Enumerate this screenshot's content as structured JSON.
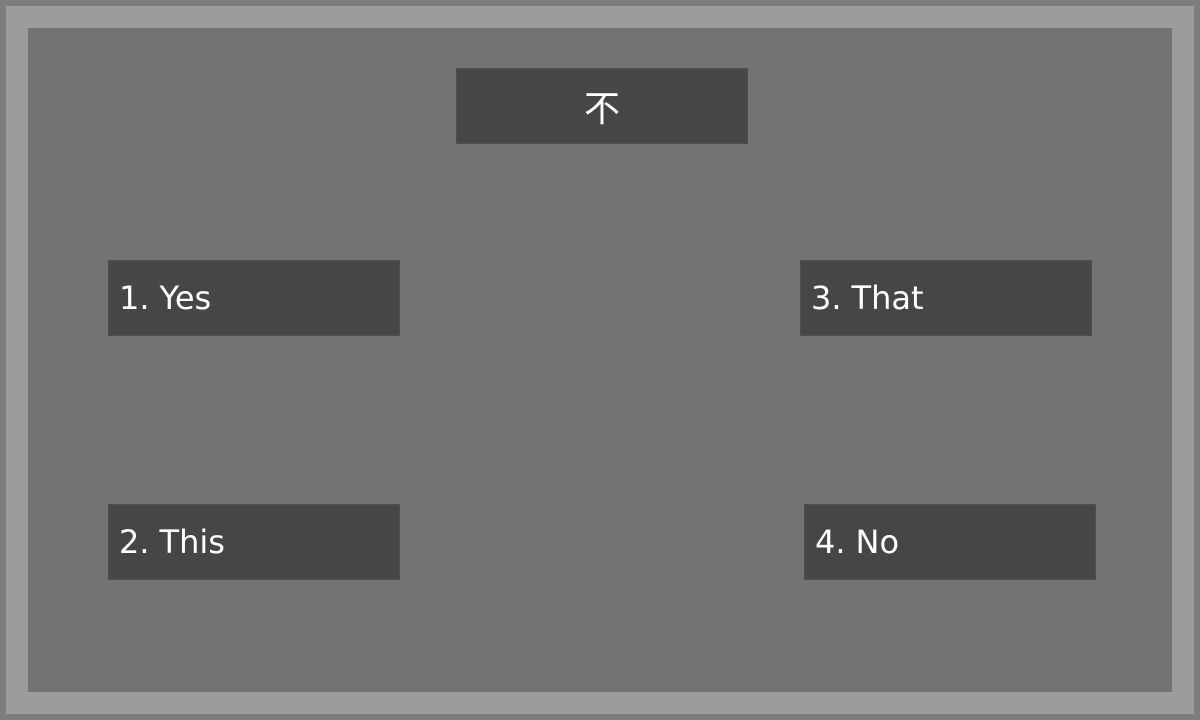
{
  "question": {
    "character": "不"
  },
  "options": [
    {
      "number": "1.",
      "label": "Yes"
    },
    {
      "number": "2.",
      "label": "This"
    },
    {
      "number": "3.",
      "label": "That"
    },
    {
      "number": "4.",
      "label": "No"
    }
  ],
  "colors": {
    "outer_frame": "#9c9c9c",
    "panel": "#737373",
    "box": "#464646",
    "text": "#ffffff"
  }
}
